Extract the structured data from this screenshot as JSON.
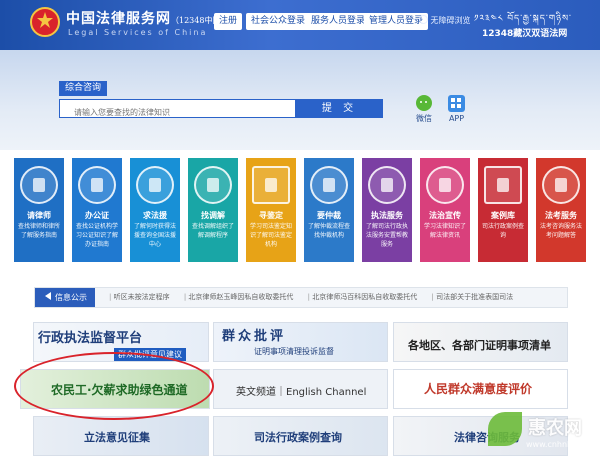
{
  "header": {
    "site_name": "中国法律服务网",
    "site_name_suffix": "（12348中国法网）",
    "site_name_en": "Legal Services of China",
    "buttons": [
      "注册",
      "社会公众登录",
      "服务人员登录",
      "管理人员登录"
    ],
    "barrier_free": "无障碍浏览",
    "tibetan_text": "༡༢༣༤༨ བོད་རྒྱ་སྐད་གཉིས་",
    "bilingual_title": "12348藏汉双语法网"
  },
  "search": {
    "tab_label": "综合咨询",
    "placeholder": "请输入您要查找的法律知识",
    "submit_label": "提 交",
    "wechat_label": "微信",
    "app_label": "APP"
  },
  "services": [
    {
      "title": "请律师",
      "desc": "查找律师和律所了解服务指南",
      "color": "#1f6fc4"
    },
    {
      "title": "办公证",
      "desc": "查找公证机构学习公证知识了解办证指南",
      "color": "#2079d0"
    },
    {
      "title": "求法援",
      "desc": "了解何时获得法援查询全国法援中心",
      "color": "#1890d6"
    },
    {
      "title": "找调解",
      "desc": "查找调解组织了解调解程序",
      "color": "#19a6a6"
    },
    {
      "title": "寻鉴定",
      "desc": "学习司法鉴定知识了解司法鉴定机构",
      "color": "#e7a317"
    },
    {
      "title": "要仲裁",
      "desc": "了解仲裁流程查找仲裁机构",
      "color": "#2c7ac9"
    },
    {
      "title": "执法服务",
      "desc": "了解司法行政执法服务安置帮教服务",
      "color": "#7b3fa3"
    },
    {
      "title": "法治宣传",
      "desc": "学习法律知识了解法律资讯",
      "color": "#d9407c"
    },
    {
      "title": "案例库",
      "desc": "司法行政案例查询",
      "color": "#c72b34"
    },
    {
      "title": "法考服务",
      "desc": "法考咨询服务法考问题解答",
      "color": "#d2382c"
    }
  ],
  "notice": {
    "label": "信息公示",
    "items": [
      "听区未按法定程序",
      "北京律师赵玉峰因私自收取委托代",
      "北京律师冯百科因私自收取委托代",
      "司法部关于批准表国司法"
    ]
  },
  "banners": {
    "b1_main": "行政执法监督平台",
    "b1_sub": "群众批评意见建议",
    "b2_main": "群众批评",
    "b2_sub": "证明事项清理投诉监督",
    "b3_main": "各地区、各部门证明事项清单",
    "b4_main": "农民工·欠薪求助绿色通道",
    "b5_main": "英文频道｜English Channel",
    "b6_main": "人民群众满意度评价",
    "b7_main": "立法意见征集",
    "b8_main": "司法行政案例查询",
    "b9_main": "法律咨询服务"
  },
  "watermark": {
    "text": "惠农网",
    "url": "www.cnhnb.com"
  },
  "colors": {
    "header_blue": "#1c4ea8",
    "accent_blue": "#2a62c9",
    "highlight_circle": "#d9232b"
  }
}
